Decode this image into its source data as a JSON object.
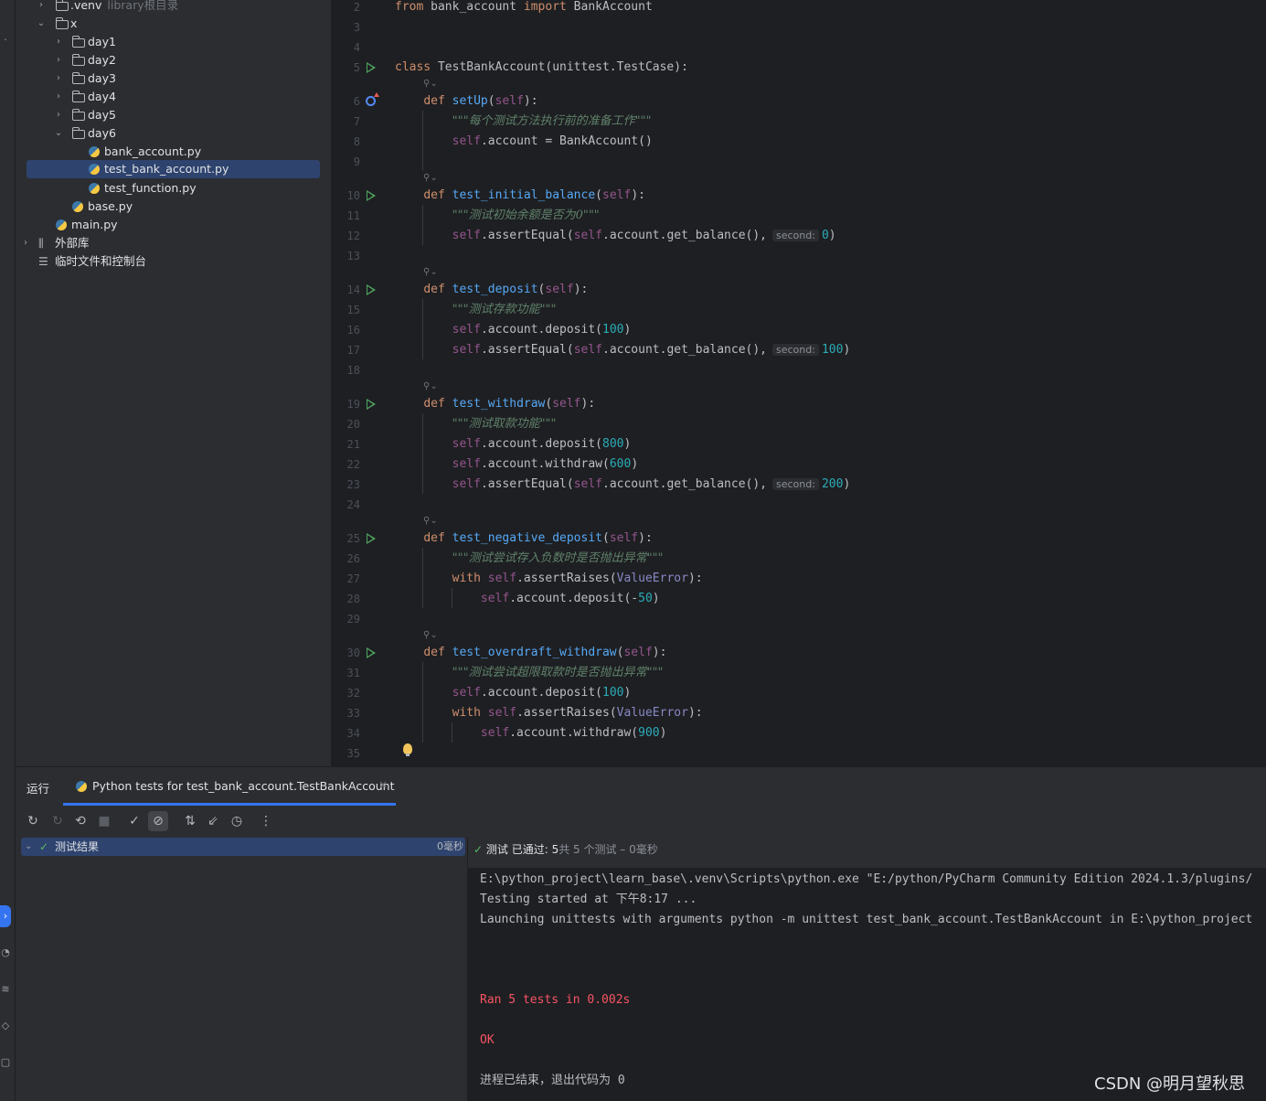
{
  "project_tree": {
    "venv": {
      "label": ".venv",
      "hint": "library根目录"
    },
    "x": "x",
    "days": [
      "day1",
      "day2",
      "day3",
      "day4",
      "day5"
    ],
    "day6": "day6",
    "files": [
      "bank_account.py",
      "test_bank_account.py",
      "test_function.py"
    ],
    "base": "base.py",
    "main": "main.py",
    "external": "外部库",
    "scratches": "临时文件和控制台"
  },
  "editor": {
    "line_numbers": [
      "2",
      "3",
      "4",
      "5",
      "6",
      "7",
      "8",
      "9",
      "10",
      "11",
      "12",
      "13",
      "14",
      "15",
      "16",
      "17",
      "18",
      "19",
      "20",
      "21",
      "22",
      "23",
      "24",
      "25",
      "26",
      "27",
      "28",
      "29",
      "30",
      "31",
      "32",
      "33",
      "34",
      "35"
    ],
    "lens_icon": "⚲⌄",
    "hint_label": "second:",
    "doc": {
      "setup": "\"\"\"每个测试方法执行前的准备工作\"\"\"",
      "initial": "\"\"\"测试初始余额是否为0\"\"\"",
      "deposit": "\"\"\"测试存款功能\"\"\"",
      "withdraw": "\"\"\"测试取款功能\"\"\"",
      "negative": "\"\"\"测试尝试存入负数时是否抛出异常\"\"\"",
      "overdraft": "\"\"\"测试尝试超限取款时是否抛出异常\"\"\""
    }
  },
  "run_panel": {
    "title": "运行",
    "tab_label": "Python tests for test_bank_account.TestBankAccount",
    "tab_close": "×",
    "toolbar_icons": [
      "rerun-icon",
      "rerun-failed-icon",
      "toggle-auto-test-icon",
      "stop-icon",
      "show-passed-icon",
      "show-ignored-icon",
      "sort-icon",
      "import-tests-icon",
      "history-icon",
      "more-icon"
    ],
    "result_label": "测试结果",
    "result_duration": "0毫秒",
    "status": {
      "prefix": "测试 已通过:",
      "count": "5",
      "suffix": "共 5 个测试 – 0毫秒"
    },
    "console": [
      "E:\\python_project\\learn_base\\.venv\\Scripts\\python.exe \"E:/python/PyCharm Community Edition 2024.1.3/plugins/",
      "Testing started at 下午8:17 ...",
      "Launching unittests with arguments python -m unittest test_bank_account.TestBankAccount in E:\\python_project",
      "Ran 5 tests in 0.002s",
      "OK",
      "进程已结束，退出代码为 0"
    ]
  },
  "watermark": "CSDN @明月望秋思"
}
